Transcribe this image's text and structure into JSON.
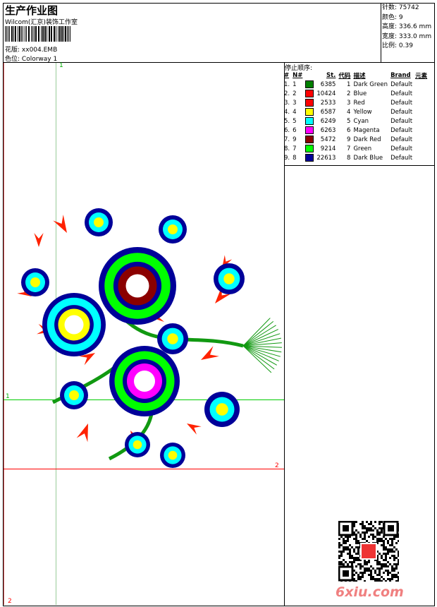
{
  "header": {
    "title": "生产作业图",
    "company": "Wilcom(汇京)装饰工作室",
    "design_label": "花版:",
    "design": "xx004.EMB",
    "colorway_label": "色位:",
    "colorway": "Colorway 1"
  },
  "stats": [
    {
      "label": "针数:",
      "value": "75742"
    },
    {
      "label": "颜色:",
      "value": "9"
    },
    {
      "label": "高度:",
      "value": "336.6 mm"
    },
    {
      "label": "宽度:",
      "value": "333.0 mm"
    },
    {
      "label": "比例:",
      "value": "0.39"
    }
  ],
  "table": {
    "title": "停止顺序:",
    "headers": [
      "#",
      "N#",
      "",
      "St.",
      "代码",
      "描述",
      "Brand",
      "元素"
    ],
    "rows": [
      {
        "i": "1.",
        "n": "1",
        "color": "#008000",
        "st": "6385",
        "code": "1",
        "desc": "Dark Green",
        "brand": "Default"
      },
      {
        "i": "2.",
        "n": "2",
        "color": "#ff0000",
        "st": "10424",
        "code": "2",
        "desc": "Blue",
        "brand": "Default"
      },
      {
        "i": "3.",
        "n": "3",
        "color": "#ff0000",
        "st": "2533",
        "code": "3",
        "desc": "Red",
        "brand": "Default"
      },
      {
        "i": "4.",
        "n": "4",
        "color": "#ffff00",
        "st": "6587",
        "code": "4",
        "desc": "Yellow",
        "brand": "Default"
      },
      {
        "i": "5.",
        "n": "5",
        "color": "#00ffff",
        "st": "6249",
        "code": "5",
        "desc": "Cyan",
        "brand": "Default"
      },
      {
        "i": "6.",
        "n": "6",
        "color": "#ff00ff",
        "st": "6263",
        "code": "6",
        "desc": "Magenta",
        "brand": "Default"
      },
      {
        "i": "7.",
        "n": "9",
        "color": "#8b0000",
        "st": "5472",
        "code": "9",
        "desc": "Dark Red",
        "brand": "Default"
      },
      {
        "i": "8.",
        "n": "7",
        "color": "#00ff00",
        "st": "9214",
        "code": "7",
        "desc": "Green",
        "brand": "Default"
      },
      {
        "i": "9.",
        "n": "8",
        "color": "#000099",
        "st": "22613",
        "code": "8",
        "desc": "Dark Blue",
        "brand": "Default"
      }
    ]
  },
  "guides": {
    "v1": "1",
    "h1": "1",
    "h2": "2",
    "v2": "2"
  },
  "watermark": "6xiu.com"
}
